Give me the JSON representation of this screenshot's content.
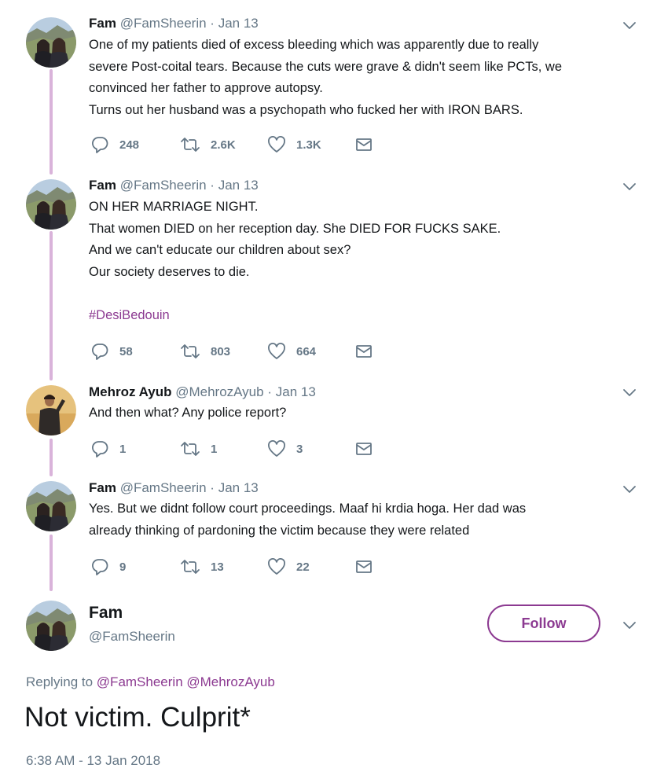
{
  "colors": {
    "accent": "#8c3a91",
    "muted": "#657786",
    "text": "#14171a",
    "thread_line": "#d9b3da"
  },
  "thread": [
    {
      "name": "Fam",
      "handle": "@FamSheerin",
      "dot": "·",
      "date": "Jan 13",
      "avatar": "fam-avatar",
      "lines": [
        "One of my patients died of excess bleeding which was apparently due to really",
        "severe Post-coital tears. Because the cuts were grave & didn't seem like PCTs, we",
        "convinced her father to approve autopsy.",
        "Turns out her husband was a psychopath who fucked her with IRON BARS."
      ],
      "hashtag": "",
      "replies": "248",
      "retweets": "2.6K",
      "likes": "1.3K"
    },
    {
      "name": "Fam",
      "handle": "@FamSheerin",
      "dot": "·",
      "date": "Jan 13",
      "avatar": "fam-avatar",
      "lines": [
        "ON HER MARRIAGE NIGHT.",
        "That women DIED on her reception day. She DIED FOR FUCKS SAKE.",
        "And we can't educate our children about sex?",
        "Our society deserves to die."
      ],
      "hashtag": "#DesiBedouin",
      "replies": "58",
      "retweets": "803",
      "likes": "664"
    },
    {
      "name": "Mehroz Ayub",
      "handle": "@MehrozAyub",
      "dot": "·",
      "date": "Jan 13",
      "avatar": "mehroz-avatar",
      "lines": [
        "And then what? Any police report?"
      ],
      "hashtag": "",
      "replies": "1",
      "retweets": "1",
      "likes": "3"
    },
    {
      "name": "Fam",
      "handle": "@FamSheerin",
      "dot": "·",
      "date": "Jan 13",
      "avatar": "fam-avatar",
      "lines": [
        "Yes. But we didnt follow court proceedings. Maaf hi krdia hoga. Her dad was",
        "already thinking of pardoning the victim because they were related"
      ],
      "hashtag": "",
      "replies": "9",
      "retweets": "13",
      "likes": "22"
    }
  ],
  "main_tweet": {
    "name": "Fam",
    "handle": "@FamSheerin",
    "follow_label": "Follow",
    "replying_prefix": "Replying to",
    "reply_mention_1": "@FamSheerin",
    "reply_mention_2": "@MehrozAyub",
    "text": "Not victim. Culprit*",
    "timestamp": "6:38 AM - 13 Jan 2018"
  }
}
